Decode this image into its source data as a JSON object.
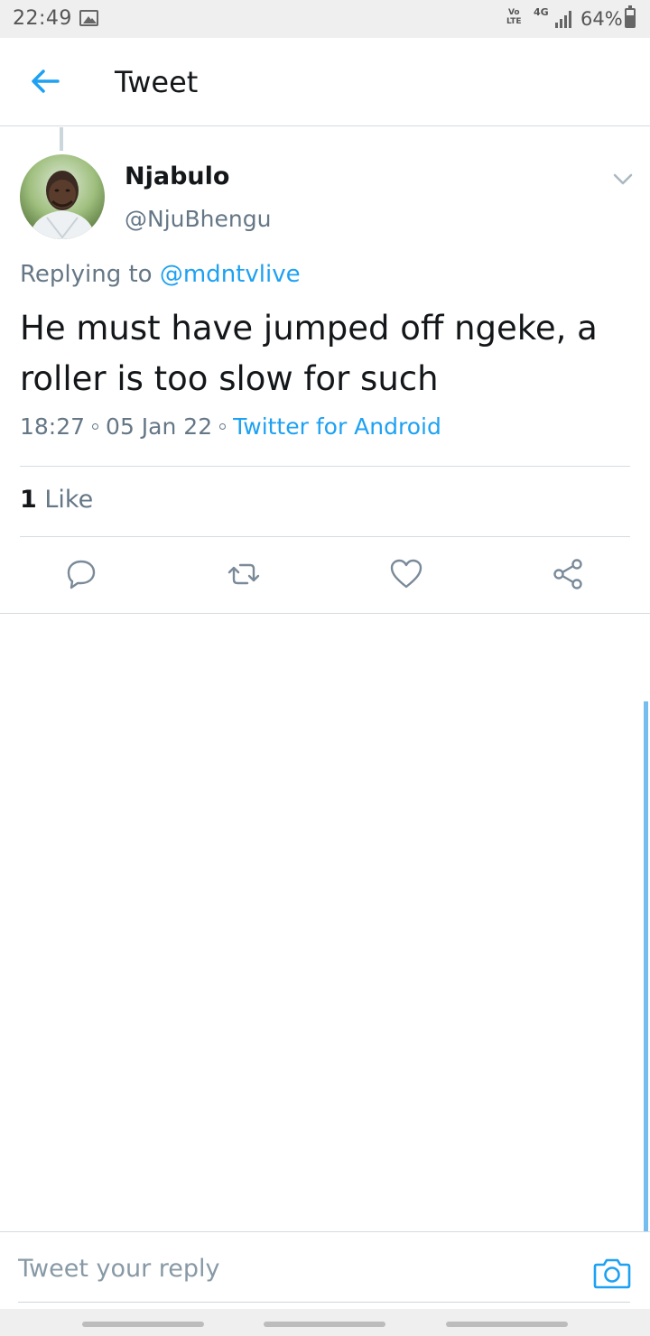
{
  "status_bar": {
    "time": "22:49",
    "volte": "Vo\nLTE",
    "network": "4G",
    "battery_percent_text": "64%",
    "battery_level": 0.64
  },
  "header": {
    "title": "Tweet",
    "back_icon": "arrow-left-icon"
  },
  "tweet": {
    "author_name": "Njabulo",
    "author_handle": "@NjuBhengu",
    "reply_prefix": "Replying to",
    "reply_to": "@mdntvlive",
    "text": "He must have jumped off ngeke, a roller is too slow for such",
    "time": "18:27",
    "date": "05 Jan 22",
    "source": "Twitter for Android",
    "like_count": "1",
    "like_label": "Like"
  },
  "actions": [
    {
      "name": "reply-icon"
    },
    {
      "name": "retweet-icon"
    },
    {
      "name": "like-icon"
    },
    {
      "name": "share-icon"
    }
  ],
  "composer": {
    "placeholder": "Tweet your reply",
    "camera_icon": "camera-icon"
  },
  "colors": {
    "accent": "#1da1f2",
    "secondary_text": "#657786",
    "icon_gray": "#7a8a99"
  }
}
